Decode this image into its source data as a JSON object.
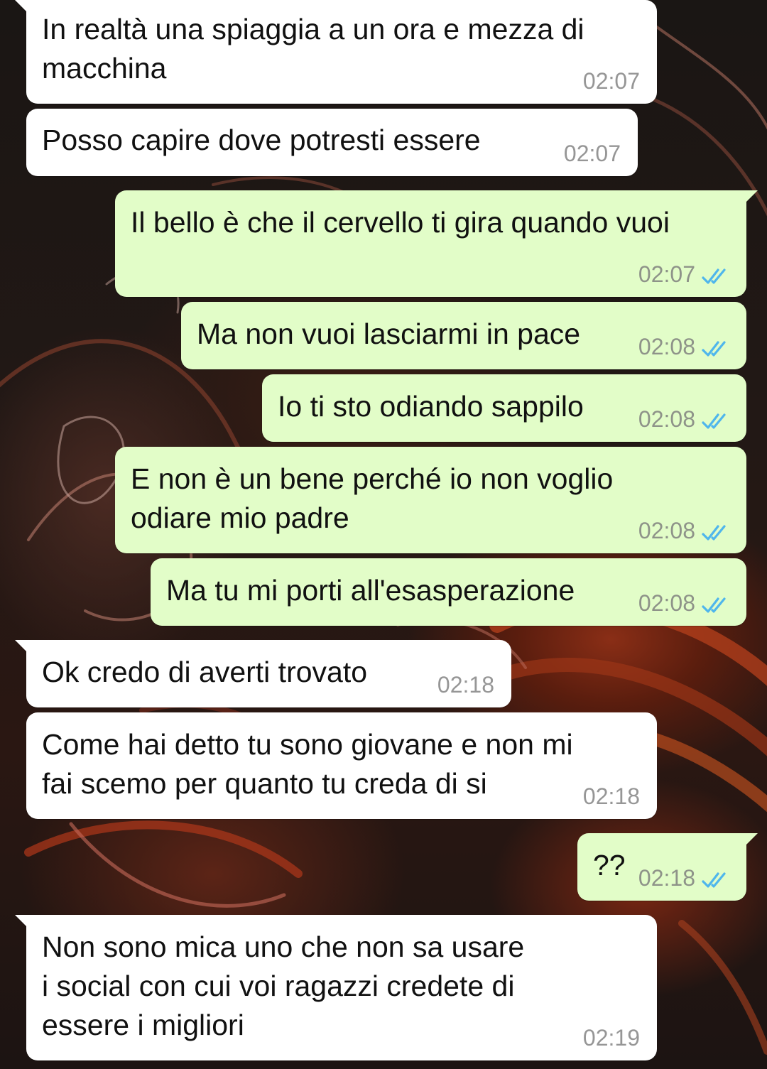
{
  "chat": {
    "accent": {
      "incoming_bubble": "#ffffff",
      "outgoing_bubble": "#e2fdc8",
      "read_check": "#4fb6ec",
      "timestamp": "#969696"
    },
    "messages": [
      {
        "direction": "in",
        "lines": [
          "In realtà una spiaggia a un ora e mezza di",
          "macchina"
        ],
        "time": "02:07"
      },
      {
        "direction": "in",
        "lines": [
          "Posso capire dove potresti essere"
        ],
        "time": "02:07"
      },
      {
        "direction": "out",
        "lines": [
          "Il bello è che il cervello ti gira quando vuoi"
        ],
        "time": "02:07",
        "status_icon": "double-check-read-icon"
      },
      {
        "direction": "out",
        "lines": [
          "Ma non vuoi lasciarmi in pace"
        ],
        "time": "02:08",
        "status_icon": "double-check-read-icon"
      },
      {
        "direction": "out",
        "lines": [
          "Io ti sto odiando sappilo"
        ],
        "time": "02:08",
        "status_icon": "double-check-read-icon"
      },
      {
        "direction": "out",
        "lines": [
          "E non è un bene perché io non voglio",
          "odiare mio padre"
        ],
        "time": "02:08",
        "status_icon": "double-check-read-icon"
      },
      {
        "direction": "out",
        "lines": [
          "Ma tu mi porti all'esasperazione"
        ],
        "time": "02:08",
        "status_icon": "double-check-read-icon"
      },
      {
        "direction": "in",
        "lines": [
          "Ok credo di averti trovato"
        ],
        "time": "02:18"
      },
      {
        "direction": "in",
        "lines": [
          "Come hai detto tu sono giovane e non mi",
          "fai scemo per quanto tu creda di si"
        ],
        "time": "02:18"
      },
      {
        "direction": "out",
        "lines": [
          "??"
        ],
        "time": "02:18",
        "status_icon": "double-check-read-icon"
      },
      {
        "direction": "in",
        "lines": [
          "Non sono mica uno che non sa usare",
          "i social con cui voi ragazzi credete di",
          "essere i migliori"
        ],
        "time": "02:19"
      }
    ]
  }
}
